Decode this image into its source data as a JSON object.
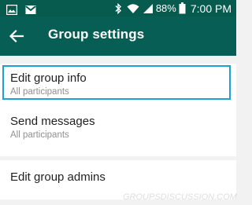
{
  "status_bar": {
    "battery_percent": "88%",
    "time": "7:00 PM",
    "icons": [
      "notification-image-icon",
      "gmail-icon",
      "bluetooth-icon",
      "wifi-icon",
      "mobile-signal-icon",
      "battery-icon"
    ]
  },
  "app_bar": {
    "title": "Group settings",
    "back_icon": "arrow-back-icon"
  },
  "settings": [
    {
      "title": "Edit group info",
      "subtitle": "All participants",
      "highlighted": true
    },
    {
      "title": "Send messages",
      "subtitle": "All participants",
      "highlighted": false
    },
    {
      "title": "Edit group admins"
    }
  ],
  "watermark": "GROUPSDISCUSSION.COM",
  "colors": {
    "status_bar": "#065a4e",
    "app_bar": "#075e54",
    "highlight_border": "#1aa3d9",
    "background": "#f2f2f2"
  }
}
